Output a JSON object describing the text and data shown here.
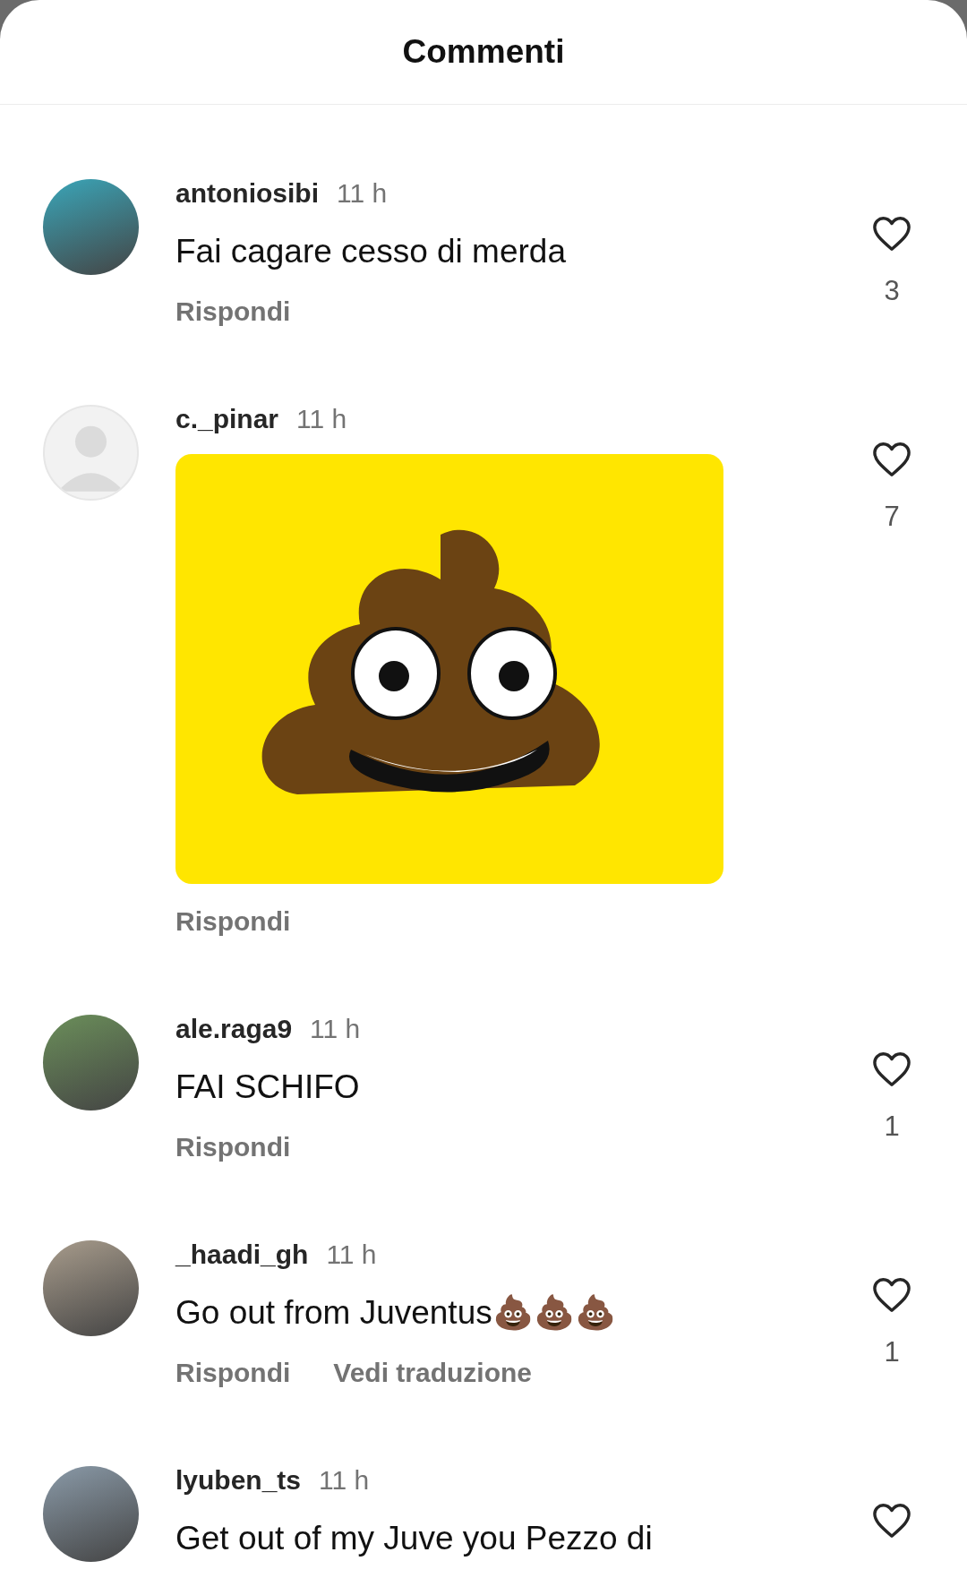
{
  "header": {
    "title": "Commenti"
  },
  "comments": [
    {
      "username": "antoniosibi",
      "time": "11 h",
      "avatar": {
        "kind": "photo"
      },
      "kind": "text",
      "text": "Fai cagare cesso di merda",
      "actions": [
        "Rispondi"
      ],
      "likes": "3",
      "liked": false
    },
    {
      "username": "c._pinar",
      "time": "11 h",
      "avatar": {
        "kind": "default"
      },
      "kind": "sticker",
      "actions": [
        "Rispondi"
      ],
      "likes": "7",
      "liked": false
    },
    {
      "username": "ale.raga9",
      "time": "11 h",
      "avatar": {
        "kind": "photo"
      },
      "kind": "text",
      "text": "FAI SCHIFO",
      "actions": [
        "Rispondi"
      ],
      "likes": "1",
      "liked": false
    },
    {
      "username": "_haadi_gh",
      "time": "11 h",
      "avatar": {
        "kind": "photo"
      },
      "kind": "text",
      "text": "Go out from Juventus💩💩💩",
      "actions": [
        "Rispondi",
        "Vedi traduzione"
      ],
      "likes": "1",
      "liked": false
    },
    {
      "username": "lyuben_ts",
      "time": "11 h",
      "avatar": {
        "kind": "photo"
      },
      "kind": "text",
      "text": "Get out of my Juve you Pezzo di",
      "liked": false
    }
  ]
}
